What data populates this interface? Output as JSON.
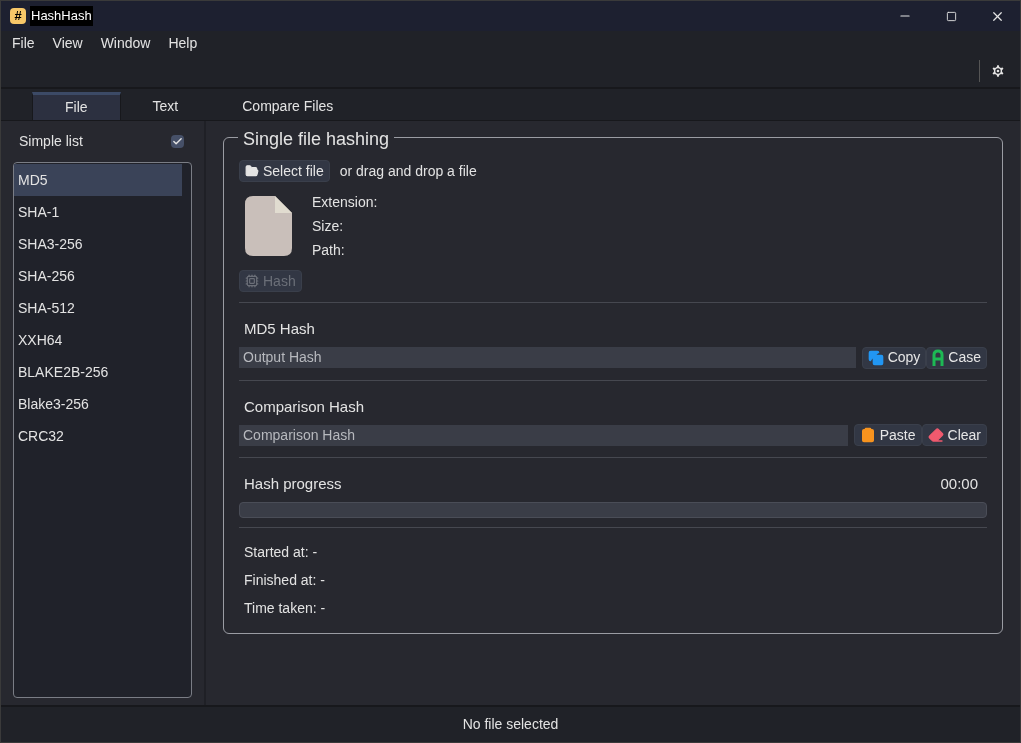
{
  "window": {
    "title": "HashHash",
    "icon_glyph": "#"
  },
  "menu": [
    "File",
    "View",
    "Window",
    "Help"
  ],
  "tabs": [
    {
      "label": "File",
      "selected": true
    },
    {
      "label": "Text",
      "selected": false
    },
    {
      "label": "Compare Files",
      "selected": false
    }
  ],
  "sidebar": {
    "simple_list": {
      "label": "Simple list",
      "checked": true
    },
    "algorithms": [
      {
        "label": "MD5",
        "selected": true
      },
      {
        "label": "SHA-1",
        "selected": false
      },
      {
        "label": "SHA3-256",
        "selected": false
      },
      {
        "label": "SHA-256",
        "selected": false
      },
      {
        "label": "SHA-512",
        "selected": false
      },
      {
        "label": "XXH64",
        "selected": false
      },
      {
        "label": "BLAKE2B-256",
        "selected": false
      },
      {
        "label": "Blake3-256",
        "selected": false
      },
      {
        "label": "CRC32",
        "selected": false
      }
    ]
  },
  "main": {
    "title": "Single file hashing",
    "select_button": "Select file",
    "drop_hint": "or drag and drop a file",
    "file_info": [
      "Extension:",
      "Size:",
      "Path:"
    ],
    "hash_button": {
      "label": "Hash",
      "disabled": true
    },
    "output": {
      "label": "MD5 Hash",
      "placeholder": "Output Hash",
      "buttons": [
        "Copy",
        "Case"
      ]
    },
    "comparison": {
      "label": "Comparison Hash",
      "placeholder": "Comparison Hash",
      "buttons": [
        "Paste",
        "Clear"
      ]
    },
    "progress": {
      "label": "Hash progress",
      "time": "00:00",
      "level": 0
    },
    "stats": [
      "Started at: -",
      "Finished at: -",
      "Time taken: -"
    ]
  },
  "status_bar": "No file selected"
}
